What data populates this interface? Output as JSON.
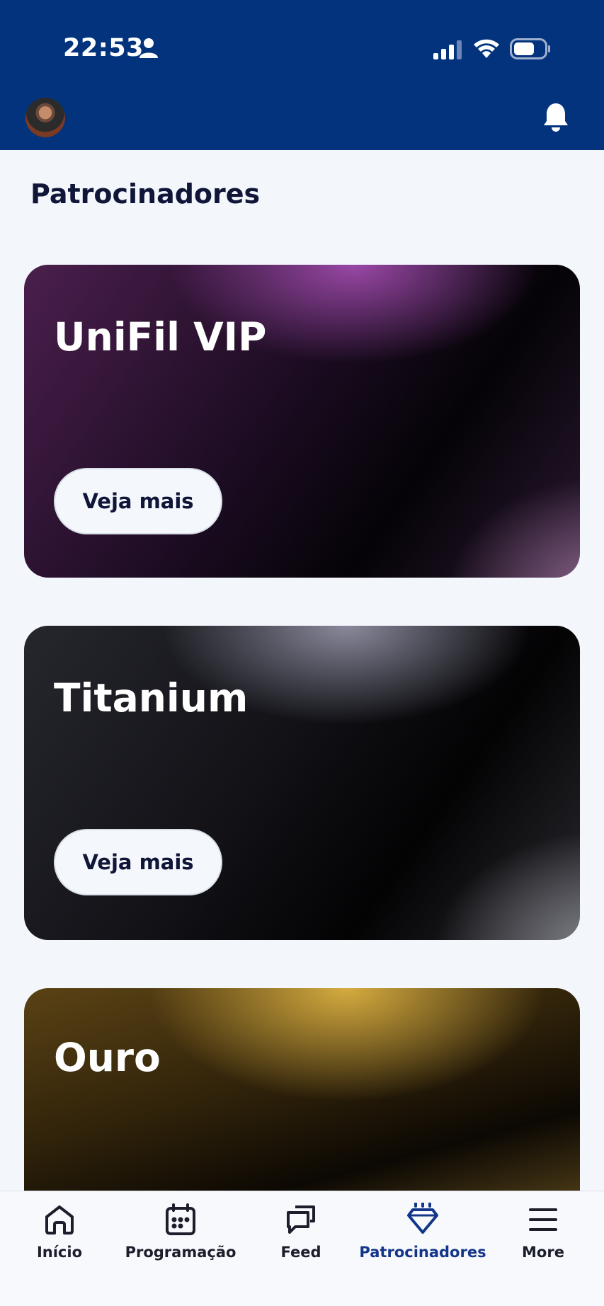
{
  "status_bar": {
    "time": "22:53",
    "icons": [
      "person-icon",
      "cellular-signal-icon",
      "wifi-icon",
      "battery-icon"
    ]
  },
  "header": {
    "avatar_icon": "profile-avatar",
    "notification_icon": "bell-icon",
    "background_color": "#03337d"
  },
  "page": {
    "title": "Patrocinadores"
  },
  "sponsor_tiers": [
    {
      "name": "UniFil VIP",
      "button_label": "Veja mais",
      "accent_color": "#a74eb4"
    },
    {
      "name": "Titanium",
      "button_label": "Veja mais",
      "accent_color": "#9696aa"
    },
    {
      "name": "Ouro",
      "accent_color": "#ddb242"
    }
  ],
  "tab_bar": {
    "active_tab": "Patrocinadores",
    "active_color": "#14368a",
    "tabs": [
      {
        "label": "Início",
        "icon": "home-icon"
      },
      {
        "label": "Programação",
        "icon": "calendar-icon"
      },
      {
        "label": "Feed",
        "icon": "chat-bubbles-icon"
      },
      {
        "label": "Patrocinadores",
        "icon": "diamond-icon"
      },
      {
        "label": "More",
        "icon": "menu-icon"
      }
    ]
  }
}
